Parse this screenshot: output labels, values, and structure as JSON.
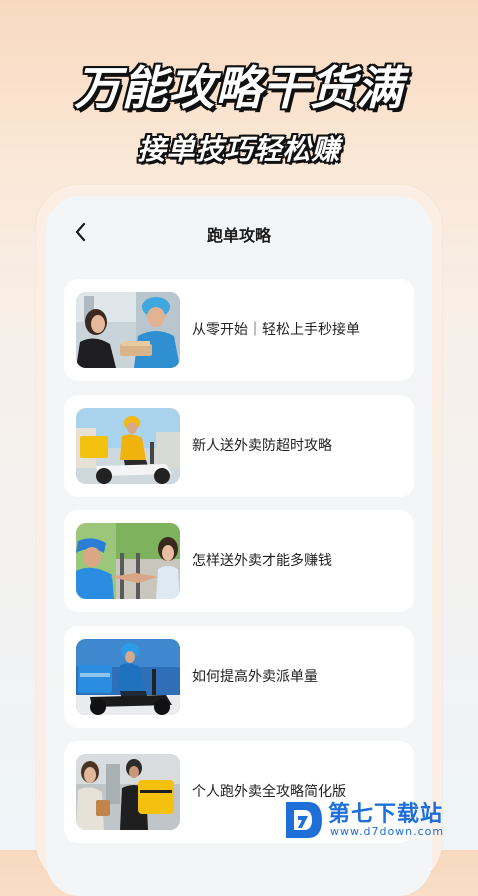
{
  "hero": {
    "title": "万能攻略干货满",
    "subtitle": "接单技巧轻松赚"
  },
  "nav": {
    "title": "跑单攻略",
    "back_icon": "chevron-left-icon"
  },
  "articles": [
    {
      "title": "从零开始｜轻松上手秒接单",
      "image": "courier-handing-delivery-photo"
    },
    {
      "title": "新人送外卖防超时攻略",
      "image": "courier-riding-scooter-photo"
    },
    {
      "title": "怎样送外卖才能多赚钱",
      "image": "courier-handshake-photo"
    },
    {
      "title": "如何提高外卖派单量",
      "image": "courier-blue-scooter-photo"
    },
    {
      "title": "个人跑外卖全攻略简化版",
      "image": "courier-yellow-bag-photo"
    }
  ],
  "watermark": {
    "brand": "第七下载站",
    "url": "www.d7down.com"
  }
}
